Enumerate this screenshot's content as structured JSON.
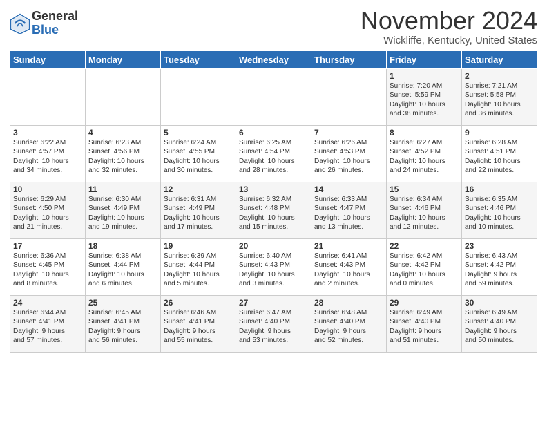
{
  "header": {
    "logo_general": "General",
    "logo_blue": "Blue",
    "month_title": "November 2024",
    "location": "Wickliffe, Kentucky, United States"
  },
  "days_of_week": [
    "Sunday",
    "Monday",
    "Tuesday",
    "Wednesday",
    "Thursday",
    "Friday",
    "Saturday"
  ],
  "weeks": [
    [
      {
        "day": "",
        "info": ""
      },
      {
        "day": "",
        "info": ""
      },
      {
        "day": "",
        "info": ""
      },
      {
        "day": "",
        "info": ""
      },
      {
        "day": "",
        "info": ""
      },
      {
        "day": "1",
        "info": "Sunrise: 7:20 AM\nSunset: 5:59 PM\nDaylight: 10 hours\nand 38 minutes."
      },
      {
        "day": "2",
        "info": "Sunrise: 7:21 AM\nSunset: 5:58 PM\nDaylight: 10 hours\nand 36 minutes."
      }
    ],
    [
      {
        "day": "3",
        "info": "Sunrise: 6:22 AM\nSunset: 4:57 PM\nDaylight: 10 hours\nand 34 minutes."
      },
      {
        "day": "4",
        "info": "Sunrise: 6:23 AM\nSunset: 4:56 PM\nDaylight: 10 hours\nand 32 minutes."
      },
      {
        "day": "5",
        "info": "Sunrise: 6:24 AM\nSunset: 4:55 PM\nDaylight: 10 hours\nand 30 minutes."
      },
      {
        "day": "6",
        "info": "Sunrise: 6:25 AM\nSunset: 4:54 PM\nDaylight: 10 hours\nand 28 minutes."
      },
      {
        "day": "7",
        "info": "Sunrise: 6:26 AM\nSunset: 4:53 PM\nDaylight: 10 hours\nand 26 minutes."
      },
      {
        "day": "8",
        "info": "Sunrise: 6:27 AM\nSunset: 4:52 PM\nDaylight: 10 hours\nand 24 minutes."
      },
      {
        "day": "9",
        "info": "Sunrise: 6:28 AM\nSunset: 4:51 PM\nDaylight: 10 hours\nand 22 minutes."
      }
    ],
    [
      {
        "day": "10",
        "info": "Sunrise: 6:29 AM\nSunset: 4:50 PM\nDaylight: 10 hours\nand 21 minutes."
      },
      {
        "day": "11",
        "info": "Sunrise: 6:30 AM\nSunset: 4:49 PM\nDaylight: 10 hours\nand 19 minutes."
      },
      {
        "day": "12",
        "info": "Sunrise: 6:31 AM\nSunset: 4:49 PM\nDaylight: 10 hours\nand 17 minutes."
      },
      {
        "day": "13",
        "info": "Sunrise: 6:32 AM\nSunset: 4:48 PM\nDaylight: 10 hours\nand 15 minutes."
      },
      {
        "day": "14",
        "info": "Sunrise: 6:33 AM\nSunset: 4:47 PM\nDaylight: 10 hours\nand 13 minutes."
      },
      {
        "day": "15",
        "info": "Sunrise: 6:34 AM\nSunset: 4:46 PM\nDaylight: 10 hours\nand 12 minutes."
      },
      {
        "day": "16",
        "info": "Sunrise: 6:35 AM\nSunset: 4:46 PM\nDaylight: 10 hours\nand 10 minutes."
      }
    ],
    [
      {
        "day": "17",
        "info": "Sunrise: 6:36 AM\nSunset: 4:45 PM\nDaylight: 10 hours\nand 8 minutes."
      },
      {
        "day": "18",
        "info": "Sunrise: 6:38 AM\nSunset: 4:44 PM\nDaylight: 10 hours\nand 6 minutes."
      },
      {
        "day": "19",
        "info": "Sunrise: 6:39 AM\nSunset: 4:44 PM\nDaylight: 10 hours\nand 5 minutes."
      },
      {
        "day": "20",
        "info": "Sunrise: 6:40 AM\nSunset: 4:43 PM\nDaylight: 10 hours\nand 3 minutes."
      },
      {
        "day": "21",
        "info": "Sunrise: 6:41 AM\nSunset: 4:43 PM\nDaylight: 10 hours\nand 2 minutes."
      },
      {
        "day": "22",
        "info": "Sunrise: 6:42 AM\nSunset: 4:42 PM\nDaylight: 10 hours\nand 0 minutes."
      },
      {
        "day": "23",
        "info": "Sunrise: 6:43 AM\nSunset: 4:42 PM\nDaylight: 9 hours\nand 59 minutes."
      }
    ],
    [
      {
        "day": "24",
        "info": "Sunrise: 6:44 AM\nSunset: 4:41 PM\nDaylight: 9 hours\nand 57 minutes."
      },
      {
        "day": "25",
        "info": "Sunrise: 6:45 AM\nSunset: 4:41 PM\nDaylight: 9 hours\nand 56 minutes."
      },
      {
        "day": "26",
        "info": "Sunrise: 6:46 AM\nSunset: 4:41 PM\nDaylight: 9 hours\nand 55 minutes."
      },
      {
        "day": "27",
        "info": "Sunrise: 6:47 AM\nSunset: 4:40 PM\nDaylight: 9 hours\nand 53 minutes."
      },
      {
        "day": "28",
        "info": "Sunrise: 6:48 AM\nSunset: 4:40 PM\nDaylight: 9 hours\nand 52 minutes."
      },
      {
        "day": "29",
        "info": "Sunrise: 6:49 AM\nSunset: 4:40 PM\nDaylight: 9 hours\nand 51 minutes."
      },
      {
        "day": "30",
        "info": "Sunrise: 6:49 AM\nSunset: 4:40 PM\nDaylight: 9 hours\nand 50 minutes."
      }
    ]
  ]
}
